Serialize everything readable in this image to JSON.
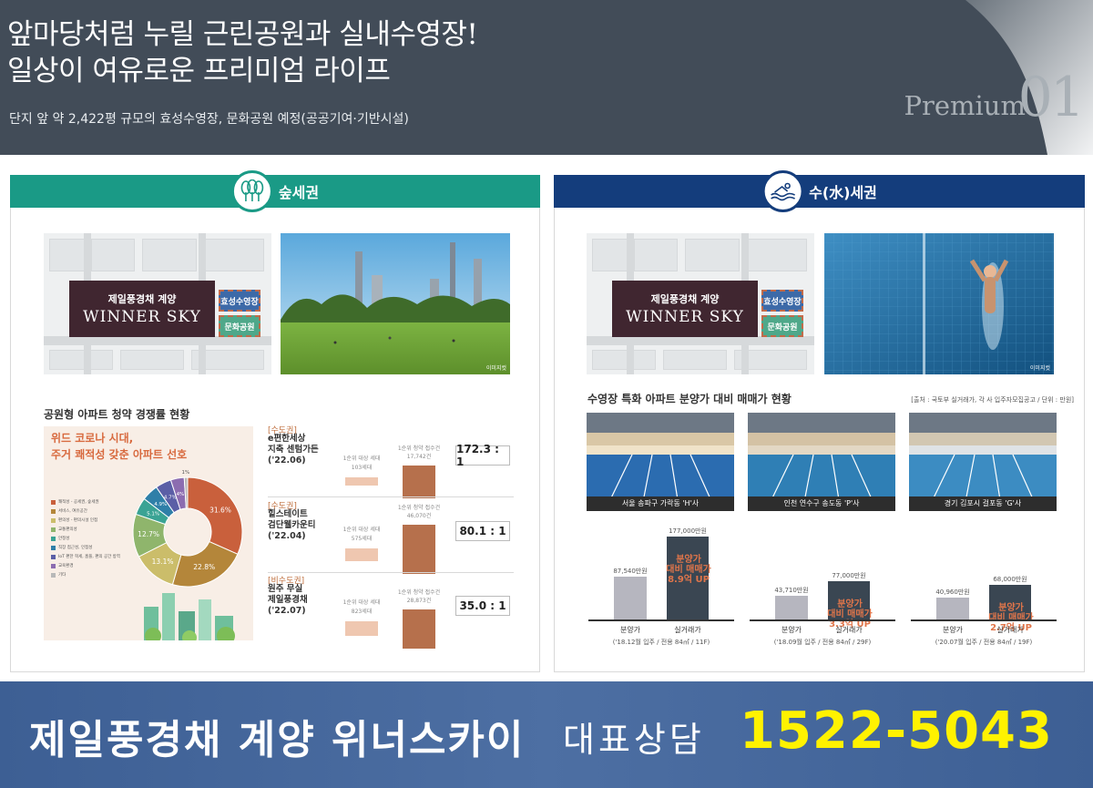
{
  "header": {
    "headline_1": "앞마당처럼 누릴 근린공원과 실내수영장!",
    "headline_2": "일상이 여유로운 프리미엄 라이프",
    "subtitle": "단지 앞 약 2,422평 규모의 효성수영장, 문화공원 예정(공공기여·기반시설)",
    "premium_label": "Premium",
    "premium_number": "01"
  },
  "colors": {
    "header_bg": "#424c58",
    "forest": "#1a9a86",
    "water": "#143d7c",
    "accent": "#b6704c",
    "footer_phone": "#fff200"
  },
  "left_panel": {
    "title": "숲세권",
    "icon": "trees-icon",
    "map": {
      "site_name": "제일풍경채 계양",
      "site_brand": "WINNER SKY",
      "tag_pool": "효성수영장",
      "tag_park": "문화공원"
    },
    "photo_credit": "이미지컷",
    "section_title": "공원형 아파트 청약 경쟁률 현황",
    "pie_title_1": "위드 코로나 시대,",
    "pie_title_2": "주거 쾌적성 갖춘 아파트 선호",
    "legend": [
      {
        "label": "쾌적성 - 공세권, 숲세권",
        "color": "#c9603c"
      },
      {
        "label": "서비스, 여유공간",
        "color": "#b4863a"
      },
      {
        "label": "편의성 - 편의시설 인접",
        "color": "#cbbd6a"
      },
      {
        "label": "교통편의성",
        "color": "#8fb56c"
      },
      {
        "label": "안정성",
        "color": "#3aa394"
      },
      {
        "label": "직장 접근성, 인접성",
        "color": "#2f7fa8"
      },
      {
        "label": "IoT 편한 혁세, 홈플, 편의 공간 방역",
        "color": "#5b5fa6"
      },
      {
        "label": "교육환경",
        "color": "#8c6db0"
      },
      {
        "label": "기타",
        "color": "#b8b8b8"
      }
    ],
    "pie_values": [
      "31.6%",
      "22.8%",
      "13.1%",
      "12.7%",
      "5.1%",
      "4.9%",
      "4.7%",
      "4%",
      "1%"
    ],
    "complexes": [
      {
        "category": "[수도권]",
        "name_1": "e편한세상",
        "name_2": "지축 센텀가든",
        "name_3": "('22.06)",
        "supply_cap": "1순위 대상 세대",
        "supply": "103세대",
        "apply_cap": "1순위 청약 접수건",
        "apply": "17,742건",
        "ratio": "172.3 : 1",
        "supply_n": 103,
        "apply_n": 17742
      },
      {
        "category": "[수도권]",
        "name_1": "힐스테이트",
        "name_2": "검단웰카운티",
        "name_3": "('22.04)",
        "supply_cap": "1순위 대상 세대",
        "supply": "575세대",
        "apply_cap": "1순위 청약 접수건",
        "apply": "46,070건",
        "ratio": "80.1 : 1",
        "supply_n": 575,
        "apply_n": 46070
      },
      {
        "category": "[비수도권]",
        "name_1": "원주 무실",
        "name_2": "제일풍경채",
        "name_3": "('22.07)",
        "supply_cap": "1순위 대상 세대",
        "supply": "823세대",
        "apply_cap": "1순위 청약 접수건",
        "apply": "28,873건",
        "ratio": "35.0 : 1",
        "supply_n": 823,
        "apply_n": 28873
      }
    ]
  },
  "right_panel": {
    "title": "수(水)세권",
    "icon": "swimmer-icon",
    "map": {
      "site_name": "제일풍경채 계양",
      "site_brand": "WINNER SKY",
      "tag_pool": "효성수영장",
      "tag_park": "문화공원"
    },
    "photo_credit": "이미지컷",
    "section_title": "수영장 특화 아파트 분양가 대비 매매가 현황",
    "source": "[출처 : 국토부 실거래가, 각 사 입주자모집공고 / 단위 : 만원]",
    "pools": [
      {
        "caption": "서울 송파구 가락동 'H'사",
        "presale": "87,540만원",
        "trade": "177,000만원",
        "up_1": "분양가",
        "up_2": "대비 매매가",
        "up_3": "8.9억 UP",
        "xlabel_1": "분양가",
        "xlabel_2": "실거래가",
        "note": "('18.12월 입주 / 전용 84㎡ / 11F)",
        "presale_n": 87540,
        "trade_n": 177000
      },
      {
        "caption": "인천 연수구 송도동 'P'사",
        "presale": "43,710만원",
        "trade": "77,000만원",
        "up_1": "분양가",
        "up_2": "대비 매매가",
        "up_3": "3.3억 UP",
        "xlabel_1": "분양가",
        "xlabel_2": "실거래가",
        "note": "('18.09월 입주 / 전용 84㎡ / 29F)",
        "presale_n": 43710,
        "trade_n": 77000
      },
      {
        "caption": "경기 김포시 걸포동 'G'사",
        "presale": "40,960만원",
        "trade": "68,000만원",
        "up_1": "분양가",
        "up_2": "대비 매매가",
        "up_3": "2.7억 UP",
        "xlabel_1": "분양가",
        "xlabel_2": "실거래가",
        "note": "('20.07월 입주 / 전용 84㎡ / 19F)",
        "presale_n": 40960,
        "trade_n": 68000
      }
    ]
  },
  "footer": {
    "brand": "제일풍경채 계양 위너스카이",
    "contact_label": "대표상담",
    "phone": "1522-5043"
  }
}
